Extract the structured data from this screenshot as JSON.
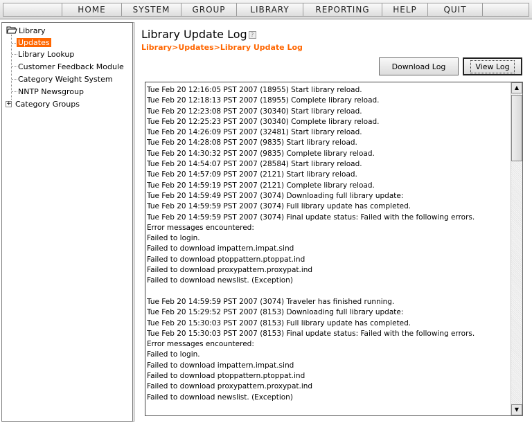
{
  "menu": [
    "HOME",
    "SYSTEM",
    "GROUP",
    "LIBRARY",
    "REPORTING",
    "HELP",
    "QUIT"
  ],
  "tree": {
    "root": "Library",
    "items": [
      "Updates",
      "Library Lookup",
      "Customer Feedback Module",
      "Category Weight System",
      "NNTP Newsgroup",
      "Category Groups"
    ],
    "selected": "Updates",
    "expand_symbol": "+"
  },
  "page": {
    "title": "Library Update Log",
    "help_symbol": "?",
    "breadcrumb": "Library>Updates>Library Update Log"
  },
  "buttons": {
    "download": "Download Log",
    "view": "View Log"
  },
  "scroll": {
    "up": "▲",
    "down": "▼"
  },
  "log_lines": [
    "Tue Feb 20 12:16:05 PST 2007 (18955) Start library reload.",
    "Tue Feb 20 12:18:13 PST 2007 (18955) Complete library reload.",
    "Tue Feb 20 12:23:08 PST 2007 (30340) Start library reload.",
    "Tue Feb 20 12:25:23 PST 2007 (30340) Complete library reload.",
    "Tue Feb 20 14:26:09 PST 2007 (32481) Start library reload.",
    "Tue Feb 20 14:28:08 PST 2007 (9835) Start library reload.",
    "Tue Feb 20 14:30:32 PST 2007 (9835) Complete library reload.",
    "Tue Feb 20 14:54:07 PST 2007 (28584) Start library reload.",
    "Tue Feb 20 14:57:09 PST 2007 (2121) Start library reload.",
    "Tue Feb 20 14:59:19 PST 2007 (2121) Complete library reload.",
    "Tue Feb 20 14:59:49 PST 2007 (3074) Downloading full library update:",
    "Tue Feb 20 14:59:59 PST 2007 (3074) Full library update has completed.",
    "Tue Feb 20 14:59:59 PST 2007 (3074) Final update status: Failed with the following errors.",
    "Error messages encountered:",
    "Failed to login.",
    "Failed to download impattern.impat.sind",
    "Failed to download ptoppattern.ptoppat.ind",
    "Failed to download proxypattern.proxypat.ind",
    "Failed to download newslist. (Exception)",
    "",
    "Tue Feb 20 14:59:59 PST 2007 (3074) Traveler has finished running.",
    "Tue Feb 20 15:29:52 PST 2007 (8153) Downloading full library update:",
    "Tue Feb 20 15:30:03 PST 2007 (8153) Full library update has completed.",
    "Tue Feb 20 15:30:03 PST 2007 (8153) Final update status: Failed with the following errors.",
    "Error messages encountered:",
    "Failed to login.",
    "Failed to download impattern.impat.sind",
    "Failed to download ptoppattern.ptoppat.ind",
    "Failed to download proxypattern.proxypat.ind",
    "Failed to download newslist. (Exception)"
  ],
  "colors": {
    "accent": "#ff6600",
    "selected_bg": "#ff6600"
  }
}
